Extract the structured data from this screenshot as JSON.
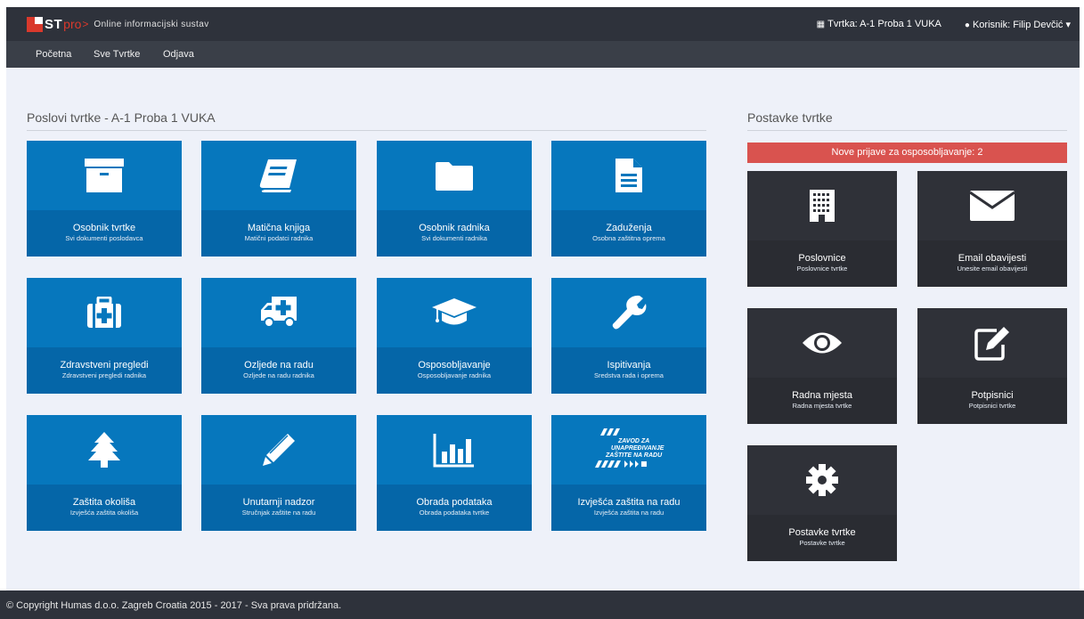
{
  "header": {
    "logo_st": "ST",
    "logo_pro": "pro",
    "logo_arrow": ">",
    "tagline": "Online informacijski sustav",
    "company_label": "Tvrtka: A-1 Proba 1 VUKA",
    "user_label": "Korisnik: Filip Devčić ▾"
  },
  "nav": {
    "items": [
      "Početna",
      "Sve Tvrtke",
      "Odjava"
    ]
  },
  "main": {
    "title": "Poslovi tvrtke - A-1 Proba 1 VUKA",
    "tiles": [
      {
        "title": "Osobnik tvrtke",
        "subtitle": "Svi dokumenti poslodavca",
        "icon": "archive-icon"
      },
      {
        "title": "Matična knjiga",
        "subtitle": "Matični podatci radnika",
        "icon": "book-icon"
      },
      {
        "title": "Osobnik radnika",
        "subtitle": "Svi dokumenti radnika",
        "icon": "folder-icon"
      },
      {
        "title": "Zaduženja",
        "subtitle": "Osobna zaštitna oprema",
        "icon": "document-icon"
      },
      {
        "title": "Zdravstveni pregledi",
        "subtitle": "Zdravstveni pregledi radnika",
        "icon": "medkit-icon"
      },
      {
        "title": "Ozljede na radu",
        "subtitle": "Ozljede na radu radnika",
        "icon": "ambulance-icon"
      },
      {
        "title": "Osposobljavanje",
        "subtitle": "Osposobljavanje radnika",
        "icon": "graduation-cap-icon"
      },
      {
        "title": "Ispitivanja",
        "subtitle": "Sredstva rada i oprema",
        "icon": "wrench-icon"
      },
      {
        "title": "Zaštita okoliša",
        "subtitle": "Izvješća zaštita okoliša",
        "icon": "tree-icon"
      },
      {
        "title": "Unutarnji nadzor",
        "subtitle": "Stručnjak zaštite na radu",
        "icon": "pencil-icon"
      },
      {
        "title": "Obrada podataka",
        "subtitle": "Obrada podataka tvrtke",
        "icon": "bar-chart-icon"
      },
      {
        "title": "Izvješća zaštita na radu",
        "subtitle": "Izvješća zaštita na radu",
        "icon": "zavod-logo-icon",
        "logo_text": [
          "ZAVOD ZA",
          "UNAPREĐIVANJE",
          "ZAŠTITE NA RADU"
        ]
      }
    ]
  },
  "side": {
    "title": "Postavke tvrtke",
    "alert": "Nove prijave za osposobljavanje: 2",
    "tiles": [
      {
        "title": "Poslovnice",
        "subtitle": "Poslovnice tvrtke",
        "icon": "building-icon"
      },
      {
        "title": "Email obavijesti",
        "subtitle": "Unesite email obavijesti",
        "icon": "envelope-icon"
      },
      {
        "title": "Radna mjesta",
        "subtitle": "Radna mjesta tvrtke",
        "icon": "eye-icon"
      },
      {
        "title": "Potpisnici",
        "subtitle": "Potpisnici tvrtke",
        "icon": "edit-icon"
      },
      {
        "title": "Postavke tvrtke",
        "subtitle": "Postavke tvrtke",
        "icon": "gear-icon"
      }
    ]
  },
  "footer": {
    "text": "© Copyright Humas d.o.o. Zagreb Croatia 2015 - 2017 - Sva prava pridržana."
  },
  "colors": {
    "tile_blue": "#0677bd",
    "tile_dark": "#2f3138",
    "alert_red": "#d9534f",
    "topbar": "#2e323b"
  }
}
